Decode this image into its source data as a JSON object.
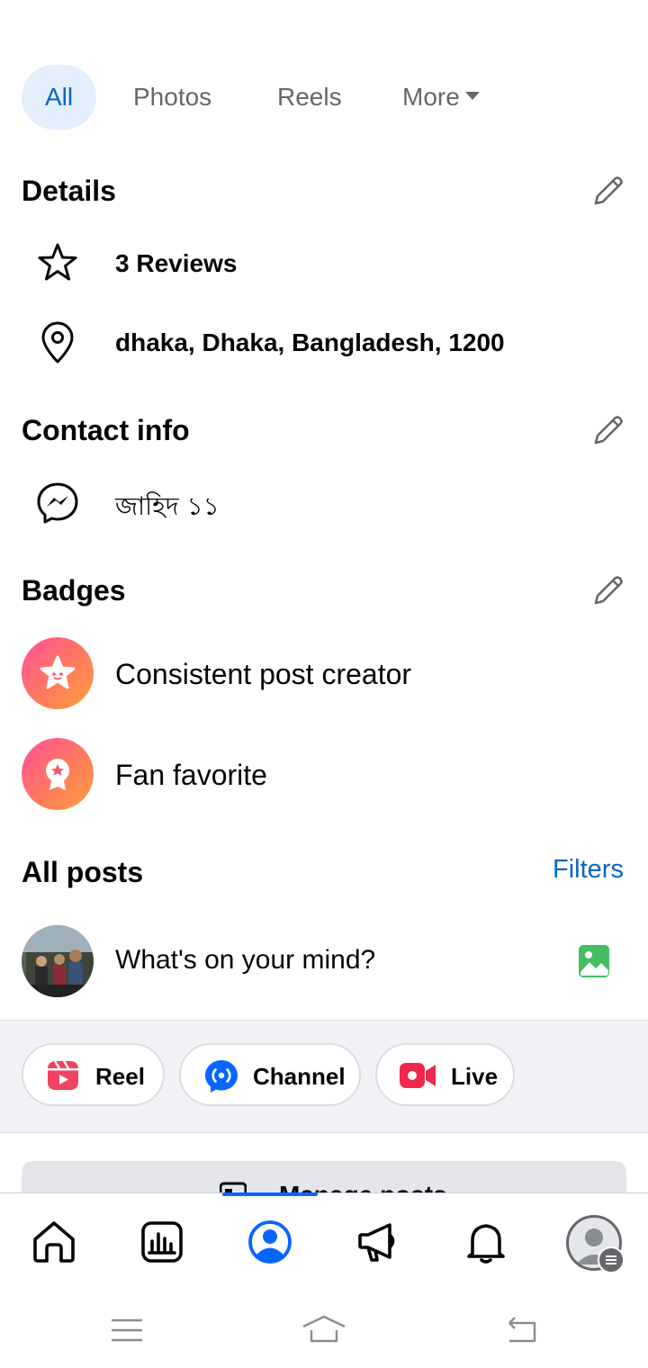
{
  "tabs": {
    "all": "All",
    "photos": "Photos",
    "reels": "Reels",
    "more": "More"
  },
  "details": {
    "title": "Details",
    "reviews": "3 Reviews",
    "location": "dhaka, Dhaka, Bangladesh, 1200"
  },
  "contact": {
    "title": "Contact info",
    "messenger": "জাহিদ ১১"
  },
  "badges": {
    "title": "Badges",
    "items": [
      "Consistent post creator",
      "Fan favorite"
    ]
  },
  "posts": {
    "title": "All posts",
    "filters": "Filters",
    "composer_placeholder": "What's on your mind?",
    "reel": "Reel",
    "channel": "Channel",
    "live": "Live",
    "manage": "Manage posts"
  },
  "colors": {
    "accent": "#0866ff",
    "link": "#0a66c2",
    "reel": "#f3425f",
    "live": "#f02849",
    "photo": "#45bd62"
  },
  "icons": [
    "star-icon",
    "location-pin-icon",
    "messenger-icon",
    "pencil-icon",
    "photo-icon",
    "reel-icon",
    "channel-icon",
    "live-video-icon",
    "home-icon",
    "insights-icon",
    "profile-icon",
    "megaphone-icon",
    "bell-icon",
    "menu-icon"
  ]
}
